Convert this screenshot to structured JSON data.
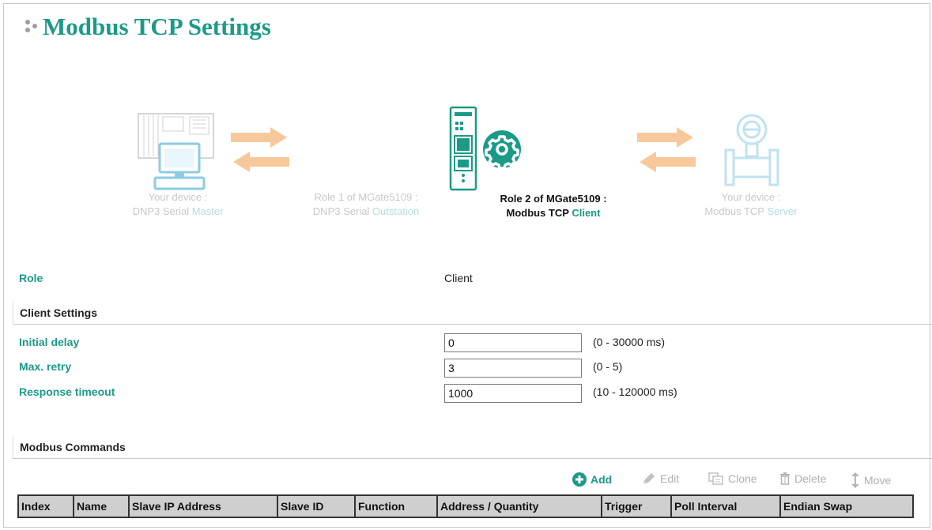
{
  "page": {
    "title": "Modbus TCP Settings"
  },
  "diagram": {
    "your_device_left": {
      "line1": "Your device :",
      "line2_prefix": "DNP3 Serial ",
      "line2_highlight": "Master"
    },
    "role1": {
      "line1": "Role 1 of MGate5109 :",
      "line2_prefix": "DNP3 Serial ",
      "line2_highlight": "Outstation"
    },
    "role2": {
      "line1": "Role 2 of MGate5109 :",
      "line2_prefix": "Modbus TCP ",
      "line2_highlight": "Client"
    },
    "your_device_right": {
      "line1": "Your device :",
      "line2_prefix": "Modbus TCP ",
      "line2_highlight": "Server"
    }
  },
  "role": {
    "label": "Role",
    "value": "Client"
  },
  "client_settings": {
    "heading": "Client Settings",
    "initial_delay": {
      "label": "Initial delay",
      "value": "0",
      "range": "(0 - 30000 ms)"
    },
    "max_retry": {
      "label": "Max. retry",
      "value": "3",
      "range": "(0 - 5)"
    },
    "response_timeout": {
      "label": "Response timeout",
      "value": "1000",
      "range": "(10 - 120000 ms)"
    }
  },
  "modbus_commands": {
    "heading": "Modbus Commands",
    "toolbar": {
      "add": "Add",
      "edit": "Edit",
      "clone": "Clone",
      "delete": "Delete",
      "move": "Move"
    },
    "columns": [
      "Index",
      "Name",
      "Slave IP Address",
      "Slave ID",
      "Function",
      "Address / Quantity",
      "Trigger",
      "Poll Interval",
      "Endian Swap"
    ]
  },
  "colors": {
    "accent": "#1b9a88",
    "arrow": "#f7c99a",
    "faded_device": "#bfe3ef"
  }
}
